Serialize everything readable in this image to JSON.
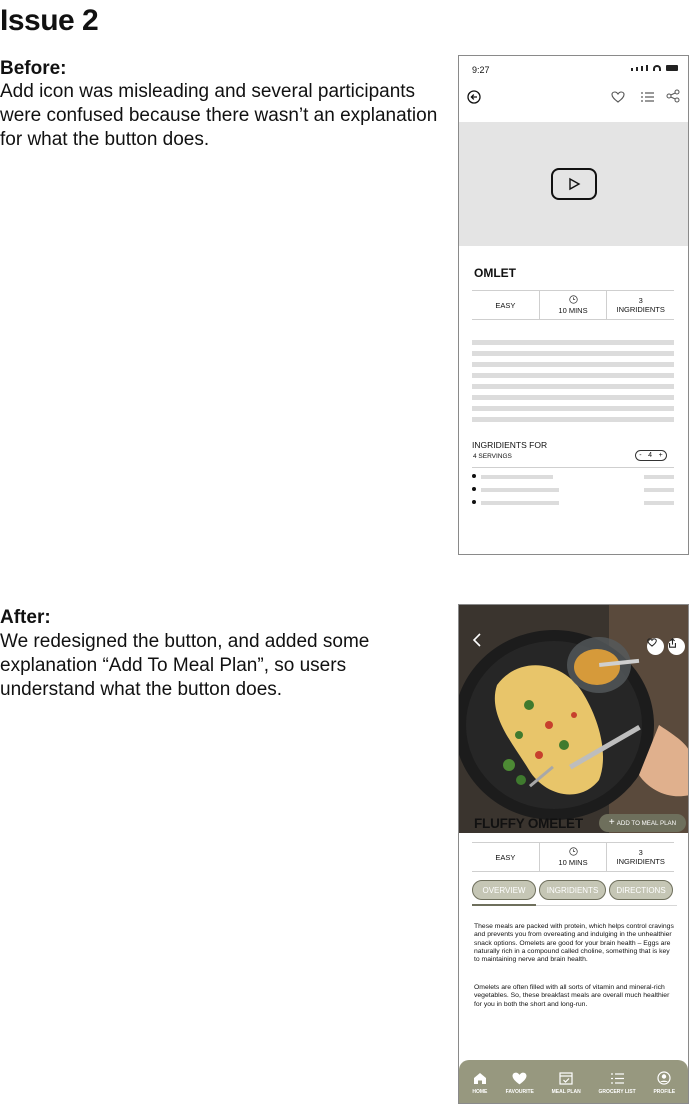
{
  "heading": "Issue 2",
  "before": {
    "label": "Before:",
    "text": "Add icon was misleading and several participants were confused because there wasn’t an explanation for what the button does."
  },
  "after": {
    "label": "After:",
    "text": "We redesigned the button, and added some explanation “Add To Meal Plan”, so users understand what the button does."
  },
  "phone_before": {
    "time": "9:27",
    "title": "OMLET",
    "stats": {
      "difficulty": "EASY",
      "time": "10 MINS",
      "count": "3",
      "count_label": "INGRIDIENTS"
    },
    "ingredients_title": "INGRIDIENTS FOR",
    "servings": "4 SERVINGS",
    "stepper": {
      "minus": "-",
      "value": "4",
      "plus": "+"
    }
  },
  "phone_after": {
    "title": "FLUFFY OMELET",
    "add_button": "ADD TO MEAL PLAN",
    "stats": {
      "difficulty": "EASY",
      "time": "10 MINS",
      "count": "3",
      "count_label": "INGRIDIENTS"
    },
    "tabs": [
      "OVERVIEW",
      "INGRIDIENTS",
      "DIRECTIONS"
    ],
    "paragraph1": "These meals are packed with protein, which helps control cravings and prevents you from overeating and indulging in the unhealthier snack options. Omelets are good for your brain health – Eggs are naturally rich in a compound called choline, something that is key to maintaining nerve and brain health.",
    "paragraph2": "Omelets are often filled with all sorts of vitamin and mineral-rich vegetables. So, these breakfast meals are overall much healthier for you in both the short and long-run.",
    "nav": [
      "HOME",
      "FAVOURITE",
      "MEAL PLAN",
      "GROCERY LIST",
      "PROFILE"
    ],
    "accent_color": "#6e6f5c",
    "nav_color": "#97987f"
  }
}
